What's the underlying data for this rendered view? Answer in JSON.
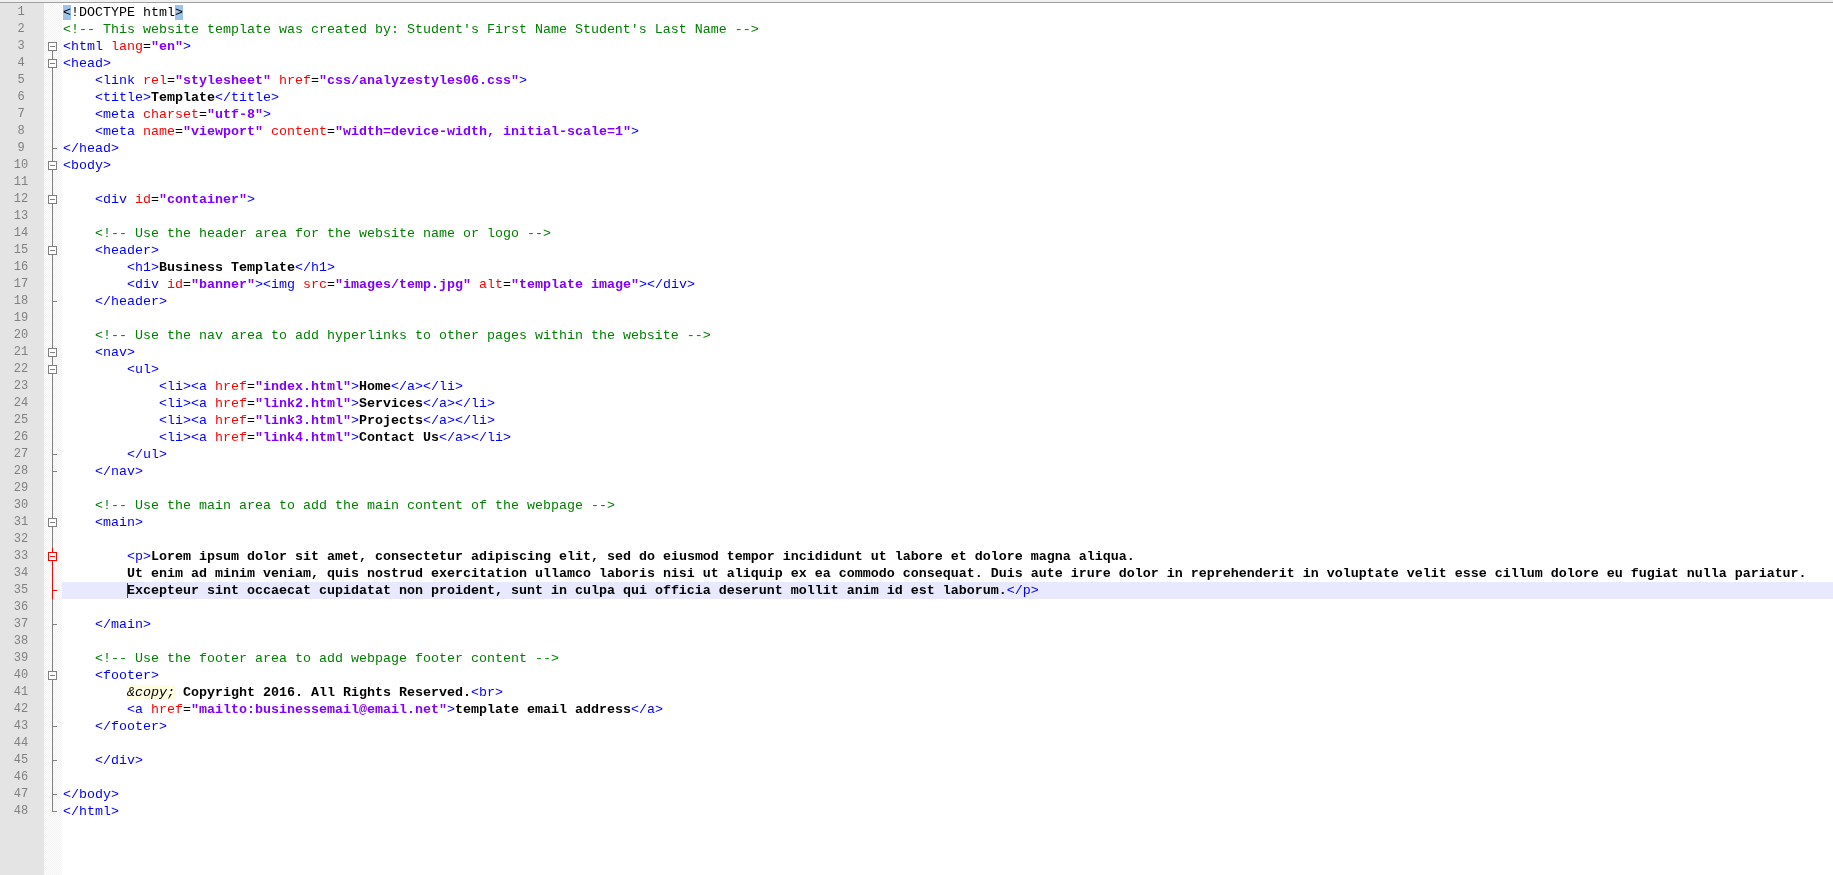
{
  "editor": {
    "lines": [
      {
        "number": "1",
        "tokens": [
          {
            "kind": "brace",
            "text": "<"
          },
          {
            "kind": "doctype",
            "text": "!DOCTYPE html"
          },
          {
            "kind": "brace",
            "text": ">"
          }
        ]
      },
      {
        "number": "2",
        "tokens": [
          {
            "kind": "comment",
            "text": "<!-- This website template was created by: Student's First Name Student's Last Name -->"
          }
        ]
      },
      {
        "number": "3",
        "fold": {
          "kind": "open"
        },
        "tokens": [
          {
            "kind": "tag",
            "text": "<html"
          },
          {
            "kind": "attr",
            "text": " lang"
          },
          {
            "kind": "op",
            "text": "="
          },
          {
            "kind": "value",
            "text": "\"en\""
          },
          {
            "kind": "tag",
            "text": ">"
          }
        ]
      },
      {
        "number": "4",
        "fold": {
          "kind": "open"
        },
        "tokens": [
          {
            "kind": "tag",
            "text": "<head>"
          }
        ]
      },
      {
        "number": "5",
        "fold": {
          "kind": "mid"
        },
        "tokens": [
          {
            "kind": "tag",
            "text": "    <link"
          },
          {
            "kind": "attr",
            "text": " rel"
          },
          {
            "kind": "op",
            "text": "="
          },
          {
            "kind": "value",
            "text": "\"stylesheet\""
          },
          {
            "kind": "attr",
            "text": " href"
          },
          {
            "kind": "op",
            "text": "="
          },
          {
            "kind": "value",
            "text": "\"css/analyzestyles06.css\""
          },
          {
            "kind": "tag",
            "text": ">"
          }
        ]
      },
      {
        "number": "6",
        "fold": {
          "kind": "mid"
        },
        "tokens": [
          {
            "kind": "tag",
            "text": "    <title>"
          },
          {
            "kind": "text",
            "text": "Template"
          },
          {
            "kind": "tag",
            "text": "</title>"
          }
        ]
      },
      {
        "number": "7",
        "fold": {
          "kind": "mid"
        },
        "tokens": [
          {
            "kind": "tag",
            "text": "    <meta"
          },
          {
            "kind": "attr",
            "text": " charset"
          },
          {
            "kind": "op",
            "text": "="
          },
          {
            "kind": "value",
            "text": "\"utf-8\""
          },
          {
            "kind": "tag",
            "text": ">"
          }
        ]
      },
      {
        "number": "8",
        "fold": {
          "kind": "mid"
        },
        "tokens": [
          {
            "kind": "tag",
            "text": "    <meta"
          },
          {
            "kind": "attr",
            "text": " name"
          },
          {
            "kind": "op",
            "text": "="
          },
          {
            "kind": "value",
            "text": "\"viewport\""
          },
          {
            "kind": "attr",
            "text": " content"
          },
          {
            "kind": "op",
            "text": "="
          },
          {
            "kind": "value",
            "text": "\"width=device-width, initial-scale=1\""
          },
          {
            "kind": "tag",
            "text": ">"
          }
        ]
      },
      {
        "number": "9",
        "fold": {
          "kind": "end"
        },
        "tokens": [
          {
            "kind": "tag",
            "text": "</head>"
          }
        ]
      },
      {
        "number": "10",
        "fold": {
          "kind": "open"
        },
        "tokens": [
          {
            "kind": "tag",
            "text": "<body>"
          }
        ]
      },
      {
        "number": "11",
        "fold": {
          "kind": "mid"
        }
      },
      {
        "number": "12",
        "fold": {
          "kind": "open"
        },
        "tokens": [
          {
            "kind": "tag",
            "text": "    <div"
          },
          {
            "kind": "attr",
            "text": " id"
          },
          {
            "kind": "op",
            "text": "="
          },
          {
            "kind": "value",
            "text": "\"container\""
          },
          {
            "kind": "tag",
            "text": ">"
          }
        ]
      },
      {
        "number": "13",
        "fold": {
          "kind": "mid"
        }
      },
      {
        "number": "14",
        "fold": {
          "kind": "mid"
        },
        "tokens": [
          {
            "kind": "comment",
            "text": "    <!-- Use the header area for the website name or logo -->"
          }
        ]
      },
      {
        "number": "15",
        "fold": {
          "kind": "open"
        },
        "tokens": [
          {
            "kind": "tag",
            "text": "    <header>"
          }
        ]
      },
      {
        "number": "16",
        "fold": {
          "kind": "mid"
        },
        "tokens": [
          {
            "kind": "tag",
            "text": "        <h1>"
          },
          {
            "kind": "text",
            "text": "Business Template"
          },
          {
            "kind": "tag",
            "text": "</h1>"
          }
        ]
      },
      {
        "number": "17",
        "fold": {
          "kind": "mid"
        },
        "tokens": [
          {
            "kind": "tag",
            "text": "        <div"
          },
          {
            "kind": "attr",
            "text": " id"
          },
          {
            "kind": "op",
            "text": "="
          },
          {
            "kind": "value",
            "text": "\"banner\""
          },
          {
            "kind": "tag",
            "text": "><img"
          },
          {
            "kind": "attr",
            "text": " src"
          },
          {
            "kind": "op",
            "text": "="
          },
          {
            "kind": "value",
            "text": "\"images/temp.jpg\""
          },
          {
            "kind": "attr",
            "text": " alt"
          },
          {
            "kind": "op",
            "text": "="
          },
          {
            "kind": "value",
            "text": "\"template image\""
          },
          {
            "kind": "tag",
            "text": "></div>"
          }
        ]
      },
      {
        "number": "18",
        "fold": {
          "kind": "end"
        },
        "tokens": [
          {
            "kind": "tag",
            "text": "    </header>"
          }
        ]
      },
      {
        "number": "19",
        "fold": {
          "kind": "mid"
        }
      },
      {
        "number": "20",
        "fold": {
          "kind": "mid"
        },
        "tokens": [
          {
            "kind": "comment",
            "text": "    <!-- Use the nav area to add hyperlinks to other pages within the website -->"
          }
        ]
      },
      {
        "number": "21",
        "fold": {
          "kind": "open"
        },
        "tokens": [
          {
            "kind": "tag",
            "text": "    <nav>"
          }
        ]
      },
      {
        "number": "22",
        "fold": {
          "kind": "open"
        },
        "tokens": [
          {
            "kind": "tag",
            "text": "        <ul>"
          }
        ]
      },
      {
        "number": "23",
        "fold": {
          "kind": "mid"
        },
        "tokens": [
          {
            "kind": "tag",
            "text": "            <li><a"
          },
          {
            "kind": "attr",
            "text": " href"
          },
          {
            "kind": "op",
            "text": "="
          },
          {
            "kind": "value",
            "text": "\"index.html\""
          },
          {
            "kind": "tag",
            "text": ">"
          },
          {
            "kind": "text",
            "text": "Home"
          },
          {
            "kind": "tag",
            "text": "</a></li>"
          }
        ]
      },
      {
        "number": "24",
        "fold": {
          "kind": "mid"
        },
        "tokens": [
          {
            "kind": "tag",
            "text": "            <li><a"
          },
          {
            "kind": "attr",
            "text": " href"
          },
          {
            "kind": "op",
            "text": "="
          },
          {
            "kind": "value",
            "text": "\"link2.html\""
          },
          {
            "kind": "tag",
            "text": ">"
          },
          {
            "kind": "text",
            "text": "Services"
          },
          {
            "kind": "tag",
            "text": "</a></li>"
          }
        ]
      },
      {
        "number": "25",
        "fold": {
          "kind": "mid"
        },
        "tokens": [
          {
            "kind": "tag",
            "text": "            <li><a"
          },
          {
            "kind": "attr",
            "text": " href"
          },
          {
            "kind": "op",
            "text": "="
          },
          {
            "kind": "value",
            "text": "\"link3.html\""
          },
          {
            "kind": "tag",
            "text": ">"
          },
          {
            "kind": "text",
            "text": "Projects"
          },
          {
            "kind": "tag",
            "text": "</a></li>"
          }
        ]
      },
      {
        "number": "26",
        "fold": {
          "kind": "mid"
        },
        "tokens": [
          {
            "kind": "tag",
            "text": "            <li><a"
          },
          {
            "kind": "attr",
            "text": " href"
          },
          {
            "kind": "op",
            "text": "="
          },
          {
            "kind": "value",
            "text": "\"link4.html\""
          },
          {
            "kind": "tag",
            "text": ">"
          },
          {
            "kind": "text",
            "text": "Contact Us"
          },
          {
            "kind": "tag",
            "text": "</a></li>"
          }
        ]
      },
      {
        "number": "27",
        "fold": {
          "kind": "end"
        },
        "tokens": [
          {
            "kind": "tag",
            "text": "        </ul>"
          }
        ]
      },
      {
        "number": "28",
        "fold": {
          "kind": "end"
        },
        "tokens": [
          {
            "kind": "tag",
            "text": "    </nav>"
          }
        ]
      },
      {
        "number": "29",
        "fold": {
          "kind": "mid"
        }
      },
      {
        "number": "30",
        "fold": {
          "kind": "mid"
        },
        "tokens": [
          {
            "kind": "comment",
            "text": "    <!-- Use the main area to add the main content of the webpage -->"
          }
        ]
      },
      {
        "number": "31",
        "fold": {
          "kind": "open"
        },
        "tokens": [
          {
            "kind": "tag",
            "text": "    <main>"
          }
        ]
      },
      {
        "number": "32",
        "fold": {
          "kind": "mid"
        }
      },
      {
        "number": "33",
        "fold": {
          "kind": "open",
          "active": true
        },
        "tokens": [
          {
            "kind": "tag",
            "text": "        <p>"
          },
          {
            "kind": "text",
            "text": "Lorem ipsum dolor sit amet, consectetur adipiscing elit, sed do eiusmod tempor incididunt ut labore et dolore magna aliqua."
          }
        ]
      },
      {
        "number": "34",
        "fold": {
          "kind": "mid",
          "active": true
        },
        "tokens": [
          {
            "kind": "text",
            "text": "        Ut enim ad minim veniam, quis nostrud exercitation ullamco laboris nisi ut aliquip ex ea commodo consequat. Duis aute irure dolor in reprehenderit in voluptate velit esse cillum dolore eu fugiat nulla pariatur."
          }
        ]
      },
      {
        "number": "35",
        "fold": {
          "kind": "end",
          "active": true
        },
        "current": true,
        "caret": true,
        "tokens": [
          {
            "kind": "text",
            "text": "        Excepteur sint occaecat cupidatat non proident, sunt in culpa qui officia deserunt mollit anim id est laborum."
          },
          {
            "kind": "tag",
            "text": "</p>"
          }
        ]
      },
      {
        "number": "36",
        "fold": {
          "kind": "mid"
        }
      },
      {
        "number": "37",
        "fold": {
          "kind": "end"
        },
        "tokens": [
          {
            "kind": "tag",
            "text": "    </main>"
          }
        ]
      },
      {
        "number": "38",
        "fold": {
          "kind": "mid"
        }
      },
      {
        "number": "39",
        "fold": {
          "kind": "mid"
        },
        "tokens": [
          {
            "kind": "comment",
            "text": "    <!-- Use the footer area to add webpage footer content -->"
          }
        ]
      },
      {
        "number": "40",
        "fold": {
          "kind": "open"
        },
        "tokens": [
          {
            "kind": "tag",
            "text": "    <footer>"
          }
        ]
      },
      {
        "number": "41",
        "fold": {
          "kind": "mid"
        },
        "tokens": [
          {
            "kind": "entity",
            "text": "        &copy;"
          },
          {
            "kind": "text",
            "text": " Copyright 2016. All Rights Reserved."
          },
          {
            "kind": "tag",
            "text": "<br>"
          }
        ]
      },
      {
        "number": "42",
        "fold": {
          "kind": "mid"
        },
        "tokens": [
          {
            "kind": "tag",
            "text": "        <a"
          },
          {
            "kind": "attr",
            "text": " href"
          },
          {
            "kind": "op",
            "text": "="
          },
          {
            "kind": "value",
            "text": "\"mailto:businessemail@email.net\""
          },
          {
            "kind": "tag",
            "text": ">"
          },
          {
            "kind": "text",
            "text": "template email address"
          },
          {
            "kind": "tag",
            "text": "</a>"
          }
        ]
      },
      {
        "number": "43",
        "fold": {
          "kind": "end"
        },
        "tokens": [
          {
            "kind": "tag",
            "text": "    </footer>"
          }
        ]
      },
      {
        "number": "44",
        "fold": {
          "kind": "mid"
        }
      },
      {
        "number": "45",
        "fold": {
          "kind": "end"
        },
        "tokens": [
          {
            "kind": "tag",
            "text": "    </div>"
          }
        ]
      },
      {
        "number": "46",
        "fold": {
          "kind": "mid"
        }
      },
      {
        "number": "47",
        "fold": {
          "kind": "end"
        },
        "tokens": [
          {
            "kind": "tag",
            "text": "</body>"
          }
        ]
      },
      {
        "number": "48",
        "fold": {
          "kind": "last"
        },
        "tokens": [
          {
            "kind": "tag",
            "text": "</html>"
          }
        ]
      }
    ]
  }
}
